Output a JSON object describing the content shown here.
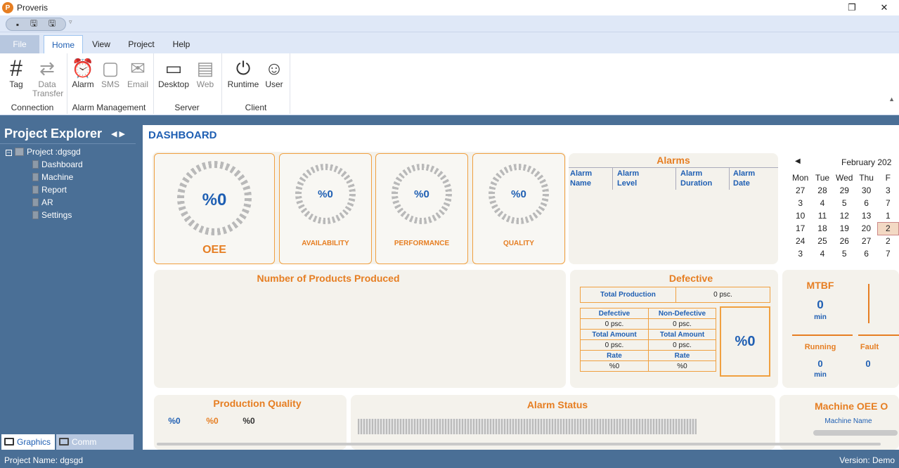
{
  "window": {
    "title": "Proveris",
    "restore_icon": "restore-icon",
    "close_icon": "close-icon"
  },
  "qat": {
    "items": [
      "new-icon",
      "save-icon",
      "save-all-icon"
    ]
  },
  "tabs": [
    "File",
    "Home",
    "View",
    "Project",
    "Help"
  ],
  "ribbon": {
    "buttons": [
      {
        "label": "Tag",
        "icon": "#"
      },
      {
        "label": "Data\nTransfer",
        "icon": "⇄"
      },
      {
        "label": "Alarm",
        "icon": "⏰"
      },
      {
        "label": "SMS",
        "icon": "✉"
      },
      {
        "label": "Email",
        "icon": "✉"
      },
      {
        "label": "Desktop",
        "icon": "🖵"
      },
      {
        "label": "Web",
        "icon": "▭"
      },
      {
        "label": "Runtime",
        "icon": "⏻"
      },
      {
        "label": "User",
        "icon": "👤"
      }
    ],
    "groups": [
      "Connection",
      "Alarm Management",
      "Server",
      "Client"
    ]
  },
  "explorer": {
    "title": "Project Explorer",
    "project": "Project :dgsgd",
    "items": [
      "Dashboard",
      "Machine",
      "Report",
      "AR",
      "Settings"
    ],
    "bottom_tabs": [
      "Graphics",
      "Comm"
    ]
  },
  "dashboard": {
    "title": "DASHBOARD",
    "kpis": [
      {
        "value": "%0",
        "label": "OEE"
      },
      {
        "value": "%0",
        "label": "AVAILABILITY"
      },
      {
        "value": "%0",
        "label": "PERFORMANCE"
      },
      {
        "value": "%0",
        "label": "QUALITY"
      }
    ],
    "alarms": {
      "title": "Alarms",
      "cols": [
        "Alarm\nName",
        "Alarm\nLevel",
        "Alarm\nDuration",
        "Alarm\nDate"
      ]
    },
    "calendar": {
      "month": "February 202",
      "days": [
        "Mon",
        "Tue",
        "Wed",
        "Thu",
        "F"
      ],
      "rows": [
        [
          "27",
          "28",
          "29",
          "30",
          "3"
        ],
        [
          "3",
          "4",
          "5",
          "6",
          "7"
        ],
        [
          "10",
          "11",
          "12",
          "13",
          "1"
        ],
        [
          "17",
          "18",
          "19",
          "20",
          "2"
        ],
        [
          "24",
          "25",
          "26",
          "27",
          "2"
        ],
        [
          "3",
          "4",
          "5",
          "6",
          "7"
        ]
      ]
    },
    "products_title": "Number of Products Produced",
    "defective": {
      "title": "Defective",
      "total_production_label": "Total Production",
      "total_production_value": "0 psc.",
      "rows": [
        [
          "Defective",
          "Non-Defective"
        ],
        [
          "0 psc.",
          "0 psc."
        ],
        [
          "Total Amount",
          "Total Amount"
        ],
        [
          "0 psc.",
          "0 psc."
        ],
        [
          "Rate",
          "Rate"
        ],
        [
          "%0",
          "%0"
        ]
      ],
      "percent": "%0"
    },
    "mtbf": {
      "title": "MTBF",
      "value": "0",
      "unit": "min",
      "running_label": "Running",
      "running_value": "0",
      "running_unit": "min",
      "fault_label": "Fault",
      "fault_value": "0"
    },
    "production_quality": {
      "title": "Production Quality",
      "values": [
        "%0",
        "%0",
        "%0"
      ]
    },
    "alarm_status": {
      "title": "Alarm Status"
    },
    "machine_oee": {
      "title": "Machine OEE O",
      "col": "Machine Name"
    }
  },
  "status": {
    "project": "Project Name: dgsgd",
    "version": "Version: Demo"
  },
  "colors": {
    "accent": "#1f5fb3",
    "orange": "#e67e22",
    "panel": "#4a6f96"
  }
}
